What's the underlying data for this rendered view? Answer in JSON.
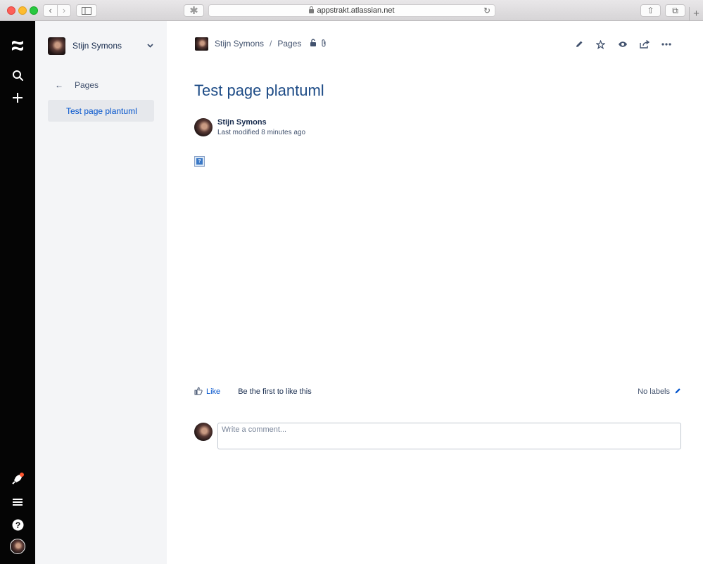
{
  "browser": {
    "url": "appstrakt.atlassian.net"
  },
  "space_sidebar": {
    "space_name": "Stijn Symons",
    "back_label": "Pages",
    "tree_item": "Test page plantuml"
  },
  "breadcrumb": {
    "space": "Stijn Symons",
    "separator": "/",
    "pages": "Pages"
  },
  "page": {
    "title": "Test page plantuml",
    "author": "Stijn Symons",
    "modified": "Last modified 8 minutes ago",
    "broken_image_glyph": "?"
  },
  "footer": {
    "like_label": "Like",
    "like_text": "Be the first to like this",
    "labels_text": "No labels"
  },
  "comment": {
    "placeholder": "Write a comment..."
  },
  "icons": [
    "confluence-logo-icon",
    "search-icon",
    "plus-icon",
    "rocket-icon",
    "hamburger-menu-icon",
    "help-icon",
    "lock-icon",
    "paperclip-icon",
    "pencil-icon",
    "star-icon",
    "eye-icon",
    "share-icon",
    "more-icon",
    "thumbs-up-icon"
  ],
  "colors": {
    "rail": "#050505",
    "sidebar": "#f4f5f7",
    "title": "#1d4b86",
    "link": "#0052cc",
    "notification": "#ff5630"
  }
}
